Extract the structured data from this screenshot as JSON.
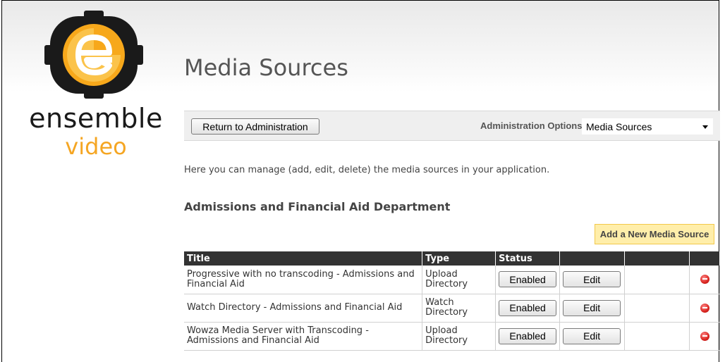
{
  "logo": {
    "word1": "ensemble",
    "word2": "video"
  },
  "page": {
    "title": "Media Sources"
  },
  "toolbar": {
    "return_label": "Return to Administration",
    "admin_options_label": "Administration Options:",
    "admin_options_value": "Media Sources"
  },
  "intro": "Here you can manage (add, edit, delete) the media sources in your application.",
  "department": "Admissions and Financial Aid Department",
  "add_button": "Add a New Media Source",
  "table": {
    "headers": {
      "title": "Title",
      "type": "Type",
      "status": "Status"
    },
    "rows": [
      {
        "title": "Progressive with no transcoding - Admissions and Financial Aid",
        "type": "Upload Directory",
        "status": "Enabled",
        "edit": "Edit"
      },
      {
        "title": "Watch Directory - Admissions and Financial Aid",
        "type": "Watch Directory",
        "status": "Enabled",
        "edit": "Edit"
      },
      {
        "title": "Wowza Media Server with Transcoding - Admissions and Financial Aid",
        "type": "Upload Directory",
        "status": "Enabled",
        "edit": "Edit"
      }
    ]
  },
  "colors": {
    "brand_orange": "#f5a623",
    "header_bg": "#333333",
    "add_button_bg": "#ffeeaa",
    "delete_red": "#d9241f"
  }
}
